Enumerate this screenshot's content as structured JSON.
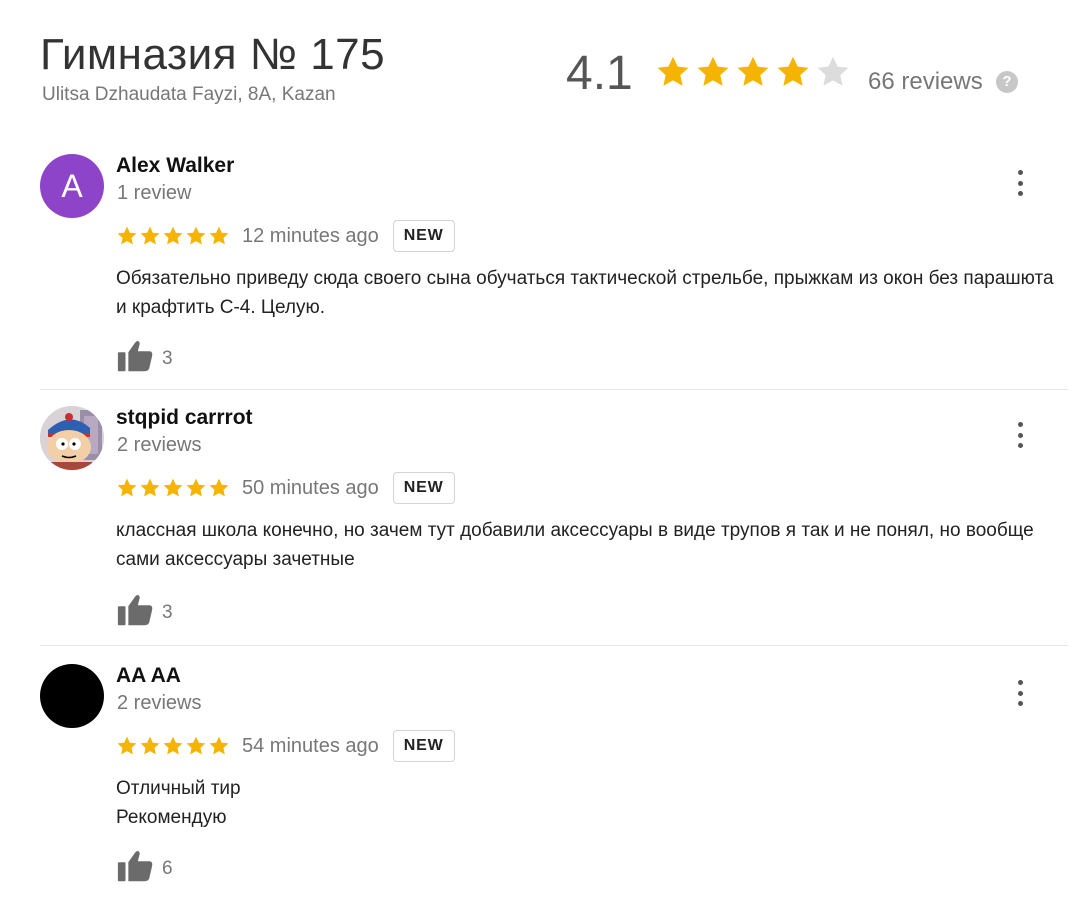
{
  "place": {
    "title": "Гимназия № 175",
    "address": "Ulitsa Dzhaudata Fayzi, 8A, Kazan",
    "rating": "4.1",
    "rating_stars": 4.1,
    "review_count": "66 reviews",
    "help_icon": "?"
  },
  "colors": {
    "star_filled": "#f4b400",
    "star_empty": "#dcdcdc",
    "avatar_a": "#8e44c9",
    "thumb": "#6b6b6b"
  },
  "icons": {
    "star": "star-icon",
    "menu": "more-vert-icon",
    "like": "thumbs-up-icon",
    "help": "help-icon"
  },
  "reviews": [
    {
      "author": "Alex Walker",
      "author_sub": "1 review",
      "avatar_letter": "A",
      "stars": 5,
      "time": "12 minutes ago",
      "badge": "NEW",
      "text": "Обязательно приведу сюда своего сына обучаться тактической стрельбе, прыжкам из окон без парашюта и крафтить С-4. Целую.",
      "likes": "3"
    },
    {
      "author": "stqpid carrrot",
      "author_sub": "2 reviews",
      "stars": 5,
      "time": "50 minutes ago",
      "badge": "NEW",
      "text": "классная школа конечно, но зачем тут добавили аксессуары в виде трупов я так и не понял, но вообще сами аксессуары зачетные",
      "likes": "3"
    },
    {
      "author": "AA AA",
      "author_sub": "2 reviews",
      "stars": 5,
      "time": "54 minutes ago",
      "badge": "NEW",
      "text": "Отличный тир\nРекомендую",
      "likes": "6"
    }
  ]
}
